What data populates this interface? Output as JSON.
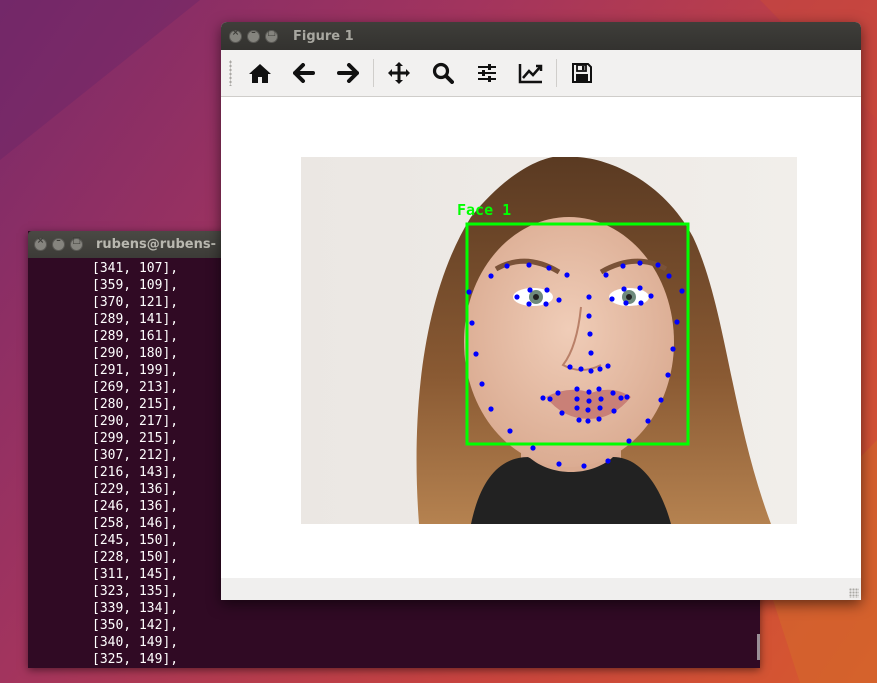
{
  "terminal": {
    "title": "rubens@rubens-",
    "lines": [
      "[341, 107],",
      "[359, 109],",
      "[370, 121],",
      "[289, 141],",
      "[289, 161],",
      "[290, 180],",
      "[291, 199],",
      "[269, 213],",
      "[280, 215],",
      "[290, 217],",
      "[299, 215],",
      "[307, 212],",
      "[216, 143],",
      "[229, 136],",
      "[246, 136],",
      "[258, 146],",
      "[245, 150],",
      "[228, 150],",
      "[311, 145],",
      "[323, 135],",
      "[339, 134],",
      "[350, 142],",
      "[340, 149],",
      "[325, 149],"
    ]
  },
  "figure": {
    "title": "Figure 1",
    "toolbar": {
      "home": "home-icon",
      "back": "arrow-left-icon",
      "forward": "arrow-right-icon",
      "pan": "move-icon",
      "zoom": "magnifier-icon",
      "configure": "sliders-icon",
      "edit_axes": "chart-line-icon",
      "save": "floppy-disk-icon"
    },
    "image": {
      "face_label": "Face 1",
      "box_color": "#00ff00",
      "landmark_color": "#0000ff"
    }
  }
}
